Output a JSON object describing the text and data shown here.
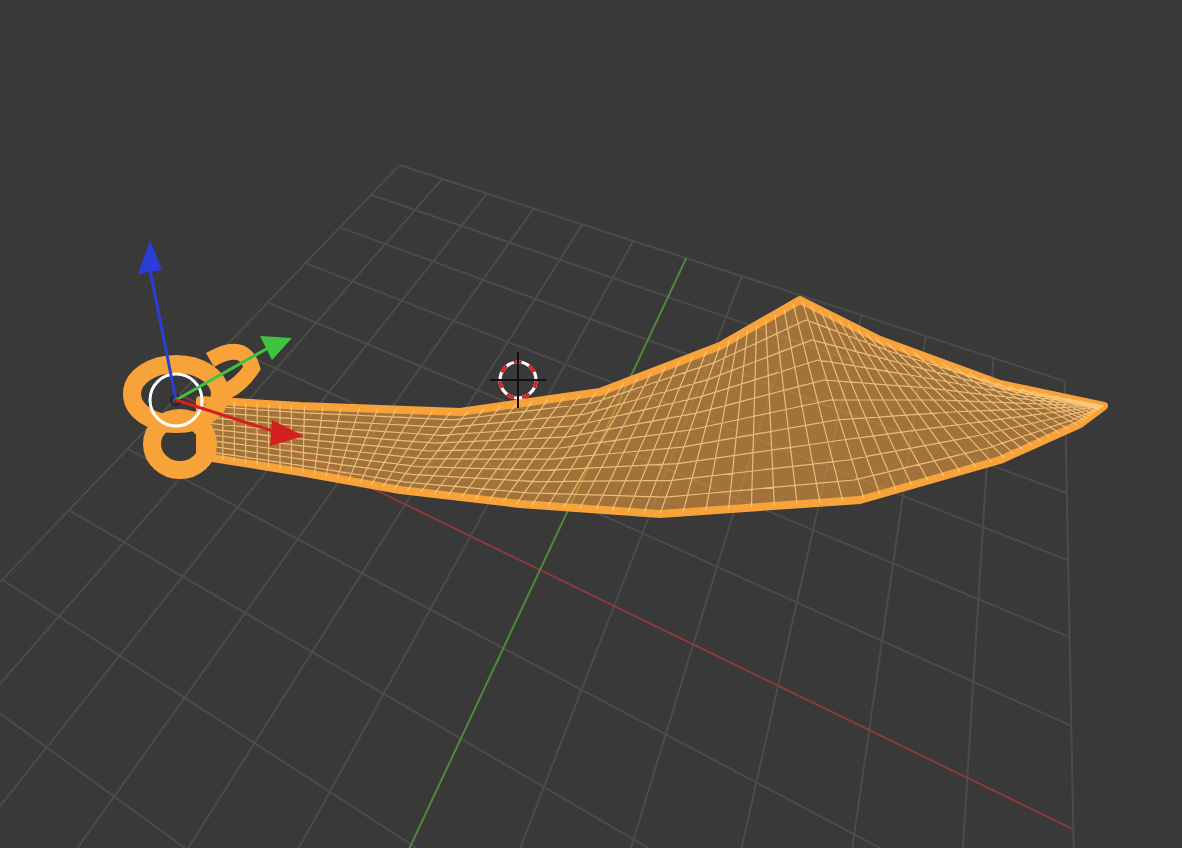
{
  "viewport": {
    "object": {
      "selected": true
    }
  }
}
